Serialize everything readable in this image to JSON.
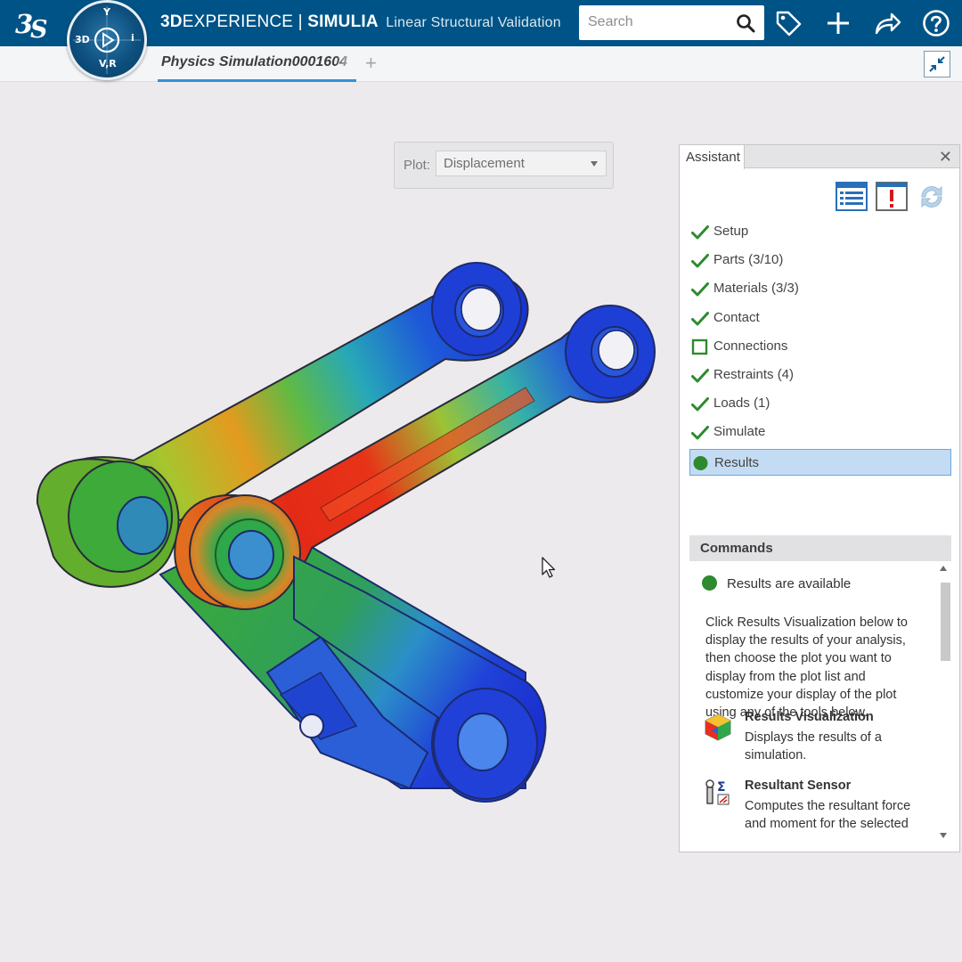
{
  "header": {
    "brand_bold": "3D",
    "brand_rest": "EXPERIENCE",
    "separator": "|",
    "product": "SIMULIA",
    "app_name": "Linear Structural Validation",
    "compass_labels": {
      "top": "Y",
      "left": "3D",
      "right": "i",
      "bottom": "V,R"
    }
  },
  "search": {
    "placeholder": "Search",
    "value": ""
  },
  "toolbar_icons": [
    "tag-icon",
    "plus-icon",
    "share-icon",
    "help-icon"
  ],
  "tab": {
    "label": "Physics Simulation0001604",
    "add_symbol": "+"
  },
  "plot": {
    "label": "Plot:",
    "value": "Displacement"
  },
  "assistant": {
    "title": "Assistant",
    "close_symbol": "✕",
    "steps": [
      {
        "label": "Setup",
        "status": "done"
      },
      {
        "label": "Parts (3/10)",
        "status": "done"
      },
      {
        "label": "Materials (3/3)",
        "status": "done"
      },
      {
        "label": "Contact",
        "status": "done"
      },
      {
        "label": "Connections",
        "status": "empty"
      },
      {
        "label": "Restraints (4)",
        "status": "done"
      },
      {
        "label": "Loads (1)",
        "status": "done"
      },
      {
        "label": "Simulate",
        "status": "done"
      },
      {
        "label": "Results",
        "status": "current"
      }
    ],
    "commands": {
      "title": "Commands",
      "status_text": "Results are available",
      "description": "Click Results Visualization below to display the results of your analysis, then choose the plot you want to display from the plot list and customize your display of the plot using any of the tools below.",
      "items": [
        {
          "title": "Results Visualization",
          "description": "Displays the results of a simulation."
        },
        {
          "title": "Resultant Sensor",
          "description": "Computes the resultant force and moment for the selected"
        }
      ]
    }
  },
  "colors": {
    "topbar": "#005386",
    "accent_blue": "#3591d3",
    "check_green": "#2e8a2e",
    "selection": "#c4dcf3"
  }
}
